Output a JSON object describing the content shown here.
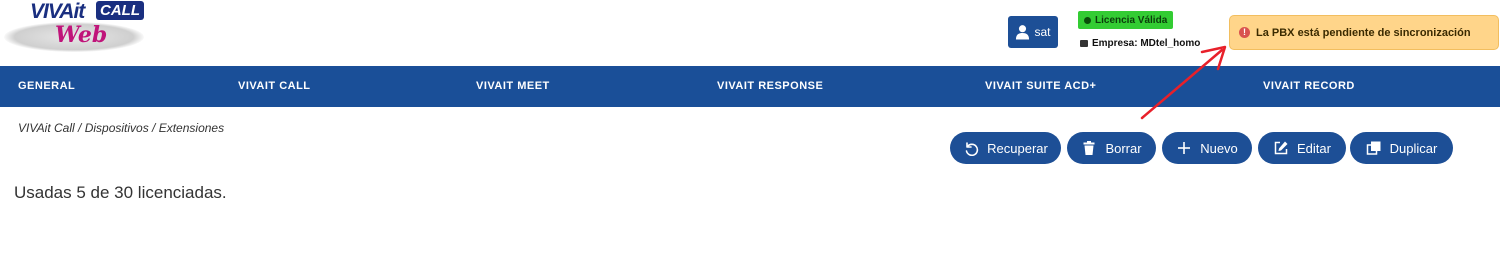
{
  "logo": {
    "brand": "VIVAit",
    "product": "CALL",
    "sub": "Web"
  },
  "user": {
    "name": "sat",
    "icon": "user-icon"
  },
  "license": {
    "status": "Licencia Válida",
    "color": "#33cc33"
  },
  "company": {
    "label": "Empresa: MDtel_homo"
  },
  "alert": {
    "text": "La PBX está pendiente de sincronización",
    "color": "#ffd58a",
    "icon": "warning-icon"
  },
  "nav": {
    "color": "#1a4f98",
    "items": [
      {
        "label": "GENERAL"
      },
      {
        "label": "VIVAIT CALL"
      },
      {
        "label": "VIVAIT MEET"
      },
      {
        "label": "VIVAIT RESPONSE"
      },
      {
        "label": "VIVAIT SUITE ACD+"
      },
      {
        "label": "VIVAIT RECORD"
      }
    ]
  },
  "breadcrumb": "VIVAit Call / Dispositivos / Extensiones",
  "toolbar": {
    "recover": "Recuperar",
    "delete": "Borrar",
    "new": "Nuevo",
    "edit": "Editar",
    "duplicate": "Duplicar"
  },
  "usage": "Usadas 5 de 30 licenciadas."
}
